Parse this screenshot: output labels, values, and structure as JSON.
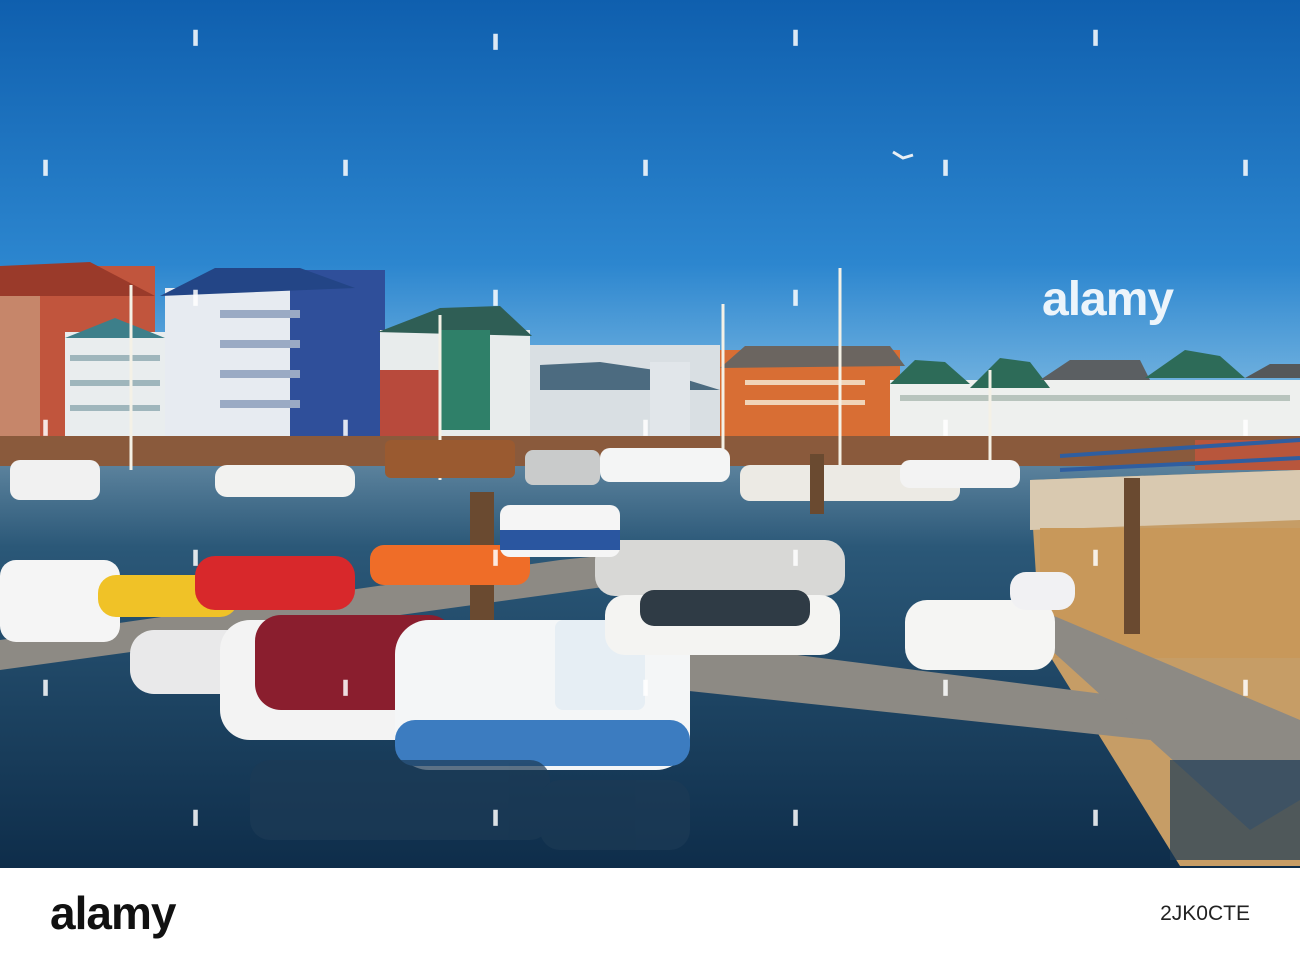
{
  "photo": {
    "watermark_logo": "alamy",
    "watermark_tile_icon": "alamy-a-icon"
  },
  "footer": {
    "logo": "alamy",
    "image_id": "2JK0CTE"
  }
}
